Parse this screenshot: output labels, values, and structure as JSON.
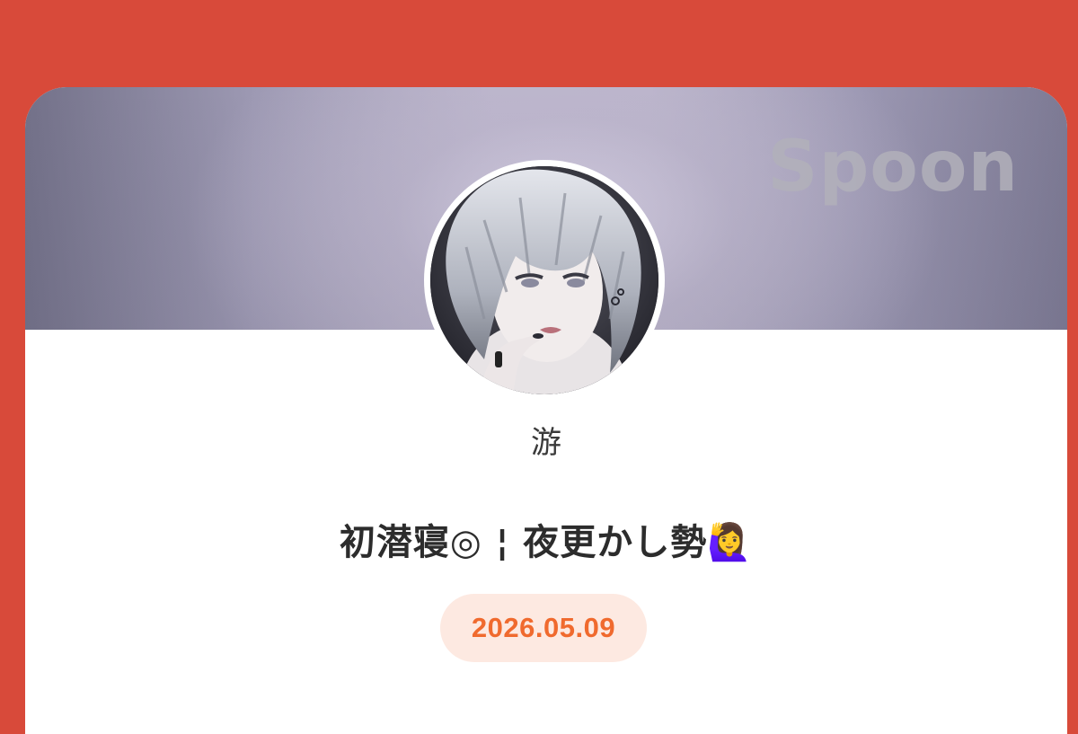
{
  "profile": {
    "brand": "Spoon",
    "nickname": "游",
    "bio": "初潜寝◎ ¦ 夜更かし勢🙋‍♀️",
    "date": "2026.05.09"
  },
  "colors": {
    "background": "#d84a3a",
    "card": "#ffffff",
    "date_text": "#f06a2e",
    "date_pill": "#fde9e1"
  },
  "icons": {
    "avatar": "profile-avatar-illustration"
  }
}
